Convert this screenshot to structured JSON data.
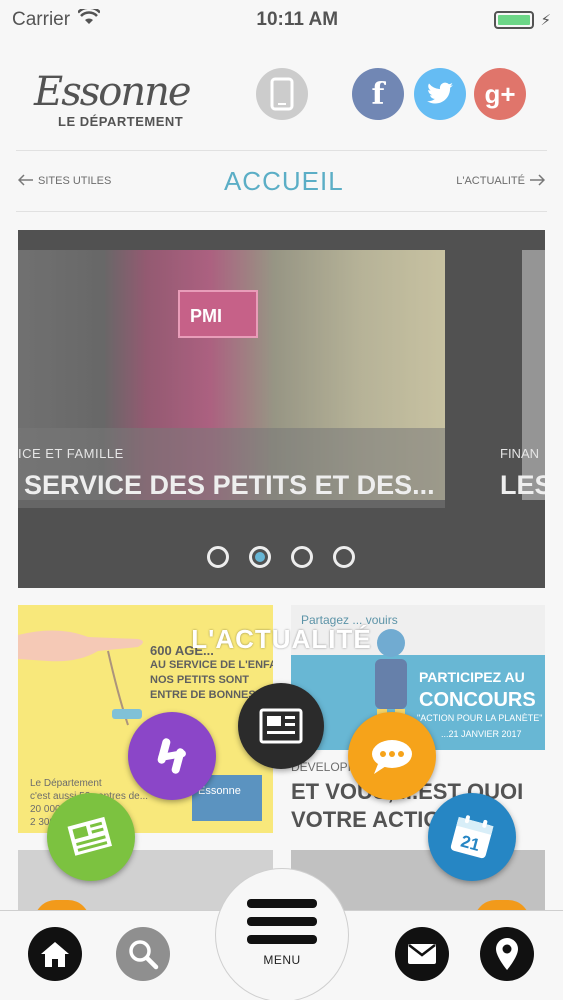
{
  "status_bar": {
    "carrier": "Carrier",
    "time": "10:11 AM"
  },
  "header": {
    "logo_script": "Essonne",
    "logo_sub": "LE DÉPARTEMENT",
    "social": [
      "phone-icon",
      "facebook-icon",
      "twitter-icon",
      "google-plus-icon"
    ]
  },
  "nav": {
    "left": "SITES UTILES",
    "title": "ACCUEIL",
    "right": "L'ACTUALITÉ"
  },
  "carousel": {
    "sign": "PMI",
    "slides": [
      {
        "category": "ICE ET FAMILLE",
        "title": "SERVICE DES PETITS ET DES..."
      },
      {
        "category": "FINAN",
        "title": "LES"
      }
    ],
    "active_dot": 2
  },
  "tiles": {
    "left": {
      "headline": [
        "600 AGE...",
        "AU SERVICE DE L'ENFANCE.",
        "NOS PETITS SONT",
        "ENTRE DE BONNES MAINS."
      ],
      "footer": [
        "Le Département",
        "c'est aussi 52 centres de...",
        "20 000...",
        "2 300..."
      ],
      "badge": "Essonne"
    },
    "right": {
      "share": "Partagez ... vouirs",
      "cta_1": "PARTICIPEZ AU",
      "cta_2": "CONCOURS",
      "cta_3": "\"ACTION POUR LA PLANÈTE\"",
      "cta_4": "...21 JANVIER 2017",
      "category": "DÉVELOPP... ...LE",
      "title": [
        "ET VOUS, ...EST QUOI",
        "VOTRE ACTIO..."
      ]
    }
  },
  "radial_menu": {
    "label": "L'ACTUALITÉ",
    "calendar_day": "21"
  },
  "bottom_bar": {
    "menu_label": "MENU"
  }
}
